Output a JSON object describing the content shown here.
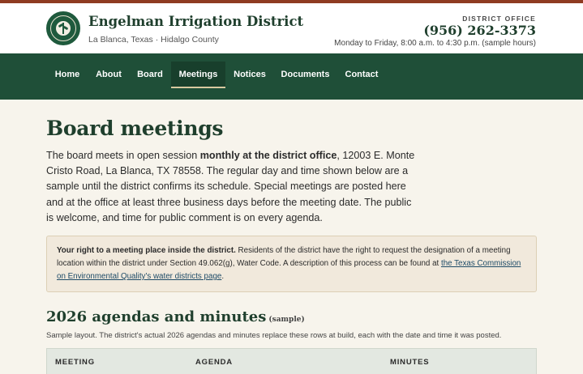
{
  "site": {
    "title": "Engelman Irrigation District",
    "subtitle": "La Blanca, Texas · Hidalgo County"
  },
  "office": {
    "label": "DISTRICT OFFICE",
    "phone": "(956) 262-3373",
    "hours": "Monday to Friday, 8:00 a.m. to 4:30 p.m. (sample hours)"
  },
  "nav": {
    "items": [
      {
        "label": "Home"
      },
      {
        "label": "About"
      },
      {
        "label": "Board"
      },
      {
        "label": "Meetings"
      },
      {
        "label": "Notices"
      },
      {
        "label": "Documents"
      },
      {
        "label": "Contact"
      }
    ],
    "active": "Meetings"
  },
  "page": {
    "title": "Board meetings",
    "intro_before": "The board meets in open session ",
    "intro_bold": "monthly at the district office",
    "intro_after": ", 12003 E. Monte Cristo Road, La Blanca, TX 78558. The regular day and time shown below are a sample until the district confirms its schedule. Special meetings are posted here and at the office at least three business days before the meeting date. The public is welcome, and time for public comment is on every agenda."
  },
  "callout": {
    "bold": "Your right to a meeting place inside the district.",
    "text": " Residents of the district have the right to request the designation of a meeting location within the district under Section 49.062(g), Water Code. A description of this process can be found at ",
    "link": "the Texas Commission on Environmental Quality's water districts page",
    "end": "."
  },
  "agendas": {
    "title": "2026 agendas and minutes",
    "tag": "(sample)",
    "note": "Sample layout. The district's actual 2026 agendas and minutes replace these rows at build, each with the date and time it was posted.",
    "columns": [
      "MEETING",
      "AGENDA",
      "MINUTES"
    ]
  },
  "colors": {
    "brand_green": "#1f4f38",
    "accent_rust": "#8f3b22",
    "background": "#f7f4ec"
  }
}
